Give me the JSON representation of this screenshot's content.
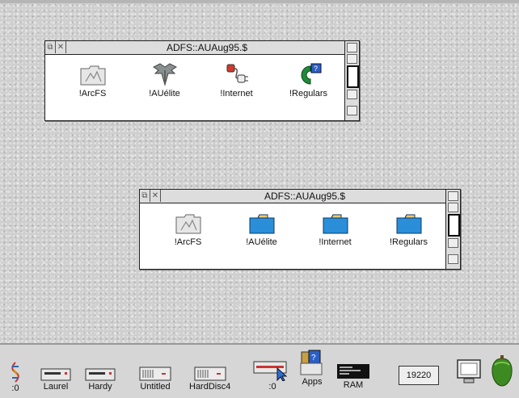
{
  "windows": [
    {
      "title": "ADFS::AUAug95.$",
      "icons": [
        {
          "label": "!ArcFS",
          "icon": "arcfs-folder-icon"
        },
        {
          "label": "!AUélite",
          "icon": "auelite-bird-icon"
        },
        {
          "label": "!Internet",
          "icon": "internet-plug-icon"
        },
        {
          "label": "!Regulars",
          "icon": "regulars-c-icon"
        }
      ]
    },
    {
      "title": "ADFS::AUAug95.$",
      "icons": [
        {
          "label": "!ArcFS",
          "icon": "arcfs-folder-icon"
        },
        {
          "label": "!AUélite",
          "icon": "folder-icon"
        },
        {
          "label": "!Internet",
          "icon": "folder-icon"
        },
        {
          "label": "!Regulars",
          "icon": "folder-icon"
        }
      ]
    }
  ],
  "iconbar": {
    "items": [
      {
        "label": ":0",
        "icon": "floppy-drive-icon"
      },
      {
        "label": "Laurel",
        "icon": "drive-icon"
      },
      {
        "label": "Hardy",
        "icon": "drive-icon"
      },
      {
        "label": "Untitled",
        "icon": "harddisc-icon"
      },
      {
        "label": "HardDisc4",
        "icon": "harddisc-icon"
      },
      {
        "label": ":0",
        "icon": "network-drive-icon"
      },
      {
        "label": "Apps",
        "icon": "apps-icon"
      },
      {
        "label": "RAM",
        "icon": "ram-disc-icon"
      }
    ],
    "memory_readout": "19220"
  },
  "colors": {
    "folder_blue": "#2a8fd8",
    "acorn_green": "#3d8a22",
    "regulars_green": "#1f8a3a"
  }
}
